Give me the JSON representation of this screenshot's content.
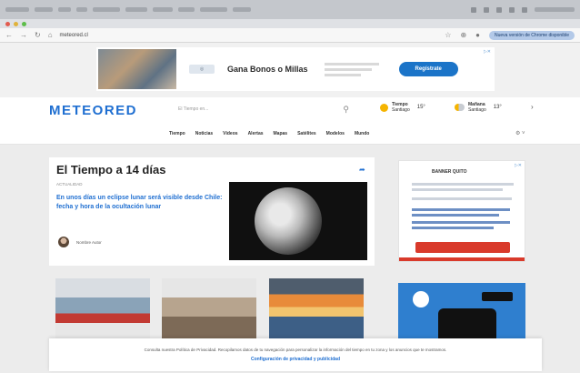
{
  "browser": {
    "url": "meteored.cl",
    "notice_button": "Nueva versión de Chrome disponible"
  },
  "ad_banner": {
    "title": "Gana Bonos o Millas",
    "cta": "Regístrate"
  },
  "header": {
    "logo": "METEORED",
    "search_placeholder": "El Tiempo en...",
    "weather": [
      {
        "city": "Tiempo",
        "sub": "Santiago",
        "temp": "15°",
        "icon": "sun-icon"
      },
      {
        "city": "Mañana",
        "sub": "Santiago",
        "temp": "13°",
        "icon": "partly-cloudy-icon"
      }
    ]
  },
  "menu": {
    "items": [
      "Tiempo",
      "Noticias",
      "Vídeos",
      "Alertas",
      "Mapas",
      "Satélites",
      "Modelos",
      "Mundo"
    ]
  },
  "main": {
    "title": "El Tiempo a 14 días",
    "category": "ACTUALIDAD",
    "headline": "En unos días un eclipse lunar será visible desde Chile: fecha y hora de la ocultación lunar",
    "author": "Nombre Autor"
  },
  "side_ad": {
    "heading": "BANNER QUITO"
  },
  "cookie": {
    "line1": "Consulta nuestra Política de Privacidad. Recopilamos datos de tu navegación para personalizar la información del tiempo en tu zona y los anuncios que te mostramos.",
    "link": "Configuración de privacidad y publicidad"
  },
  "colors": {
    "brand": "#1f6fd1",
    "cta": "#1b74c8",
    "side_ad_red": "#d93a2b"
  }
}
